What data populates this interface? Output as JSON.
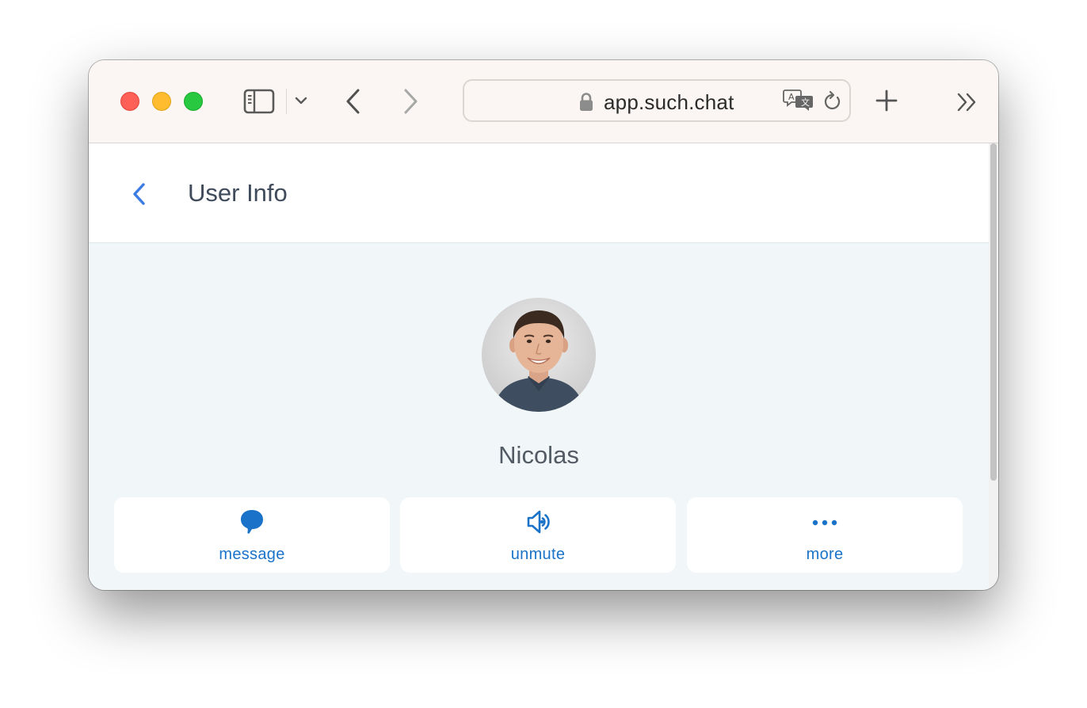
{
  "browser": {
    "url": "app.such.chat",
    "icons": {
      "sidebar": "sidebar-icon",
      "dropdown": "chevron-down-icon",
      "back": "chevron-left-icon",
      "forward": "chevron-right-icon",
      "lock": "lock-icon",
      "translate": "translate-icon",
      "reload": "reload-icon",
      "new_tab": "plus-icon",
      "overflow": "double-chevron-right-icon"
    }
  },
  "header": {
    "title": "User Info",
    "back_icon": "chevron-left-icon"
  },
  "profile": {
    "name": "Nicolas"
  },
  "actions": [
    {
      "label": "message",
      "icon": "speech-bubble-icon"
    },
    {
      "label": "unmute",
      "icon": "speaker-icon"
    },
    {
      "label": "more",
      "icon": "ellipsis-icon"
    }
  ],
  "colors": {
    "accent": "#1a73c9",
    "back_arrow": "#3b7de4",
    "page_background": "#f1f6f9",
    "toolbar_background": "#fbf6f3"
  }
}
